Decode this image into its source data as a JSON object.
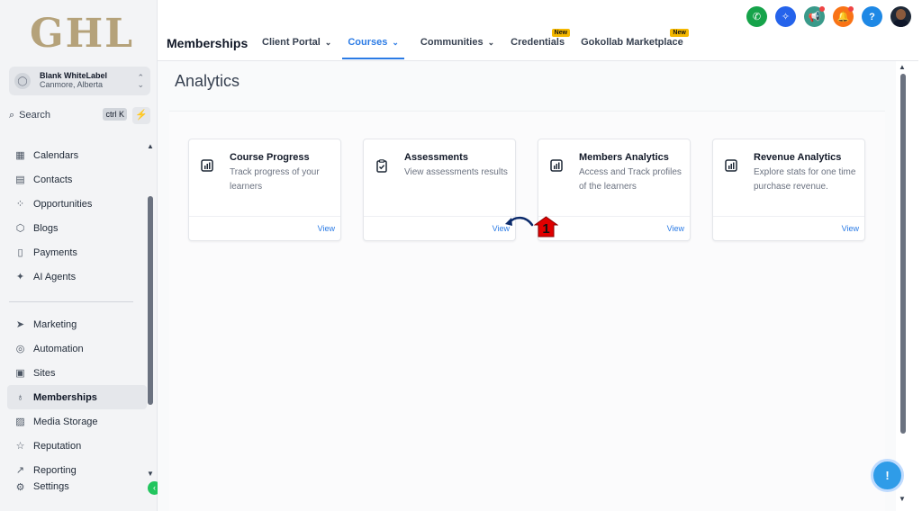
{
  "brand": {
    "logo_text": "GHL"
  },
  "account": {
    "name": "Blank WhiteLabel",
    "location": "Canmore, Alberta"
  },
  "search": {
    "label": "Search",
    "shortcut": "ctrl K"
  },
  "sidebar": {
    "items": [
      {
        "label": "Calendars",
        "icon": "calendar-icon",
        "glyph": "▦"
      },
      {
        "label": "Contacts",
        "icon": "contacts-icon",
        "glyph": "▤"
      },
      {
        "label": "Opportunities",
        "icon": "opportunities-icon",
        "glyph": "⁘"
      },
      {
        "label": "Blogs",
        "icon": "blog-icon",
        "glyph": "⬡"
      },
      {
        "label": "Payments",
        "icon": "payments-icon",
        "glyph": "▯"
      },
      {
        "label": "AI Agents",
        "icon": "ai-agents-icon",
        "glyph": "✦"
      }
    ],
    "items2": [
      {
        "label": "Marketing",
        "icon": "send-icon",
        "glyph": "➤"
      },
      {
        "label": "Automation",
        "icon": "automation-icon",
        "glyph": "◎"
      },
      {
        "label": "Sites",
        "icon": "sites-icon",
        "glyph": "▣"
      },
      {
        "label": "Memberships",
        "icon": "award-icon",
        "glyph": "♁"
      },
      {
        "label": "Media Storage",
        "icon": "image-icon",
        "glyph": "▨"
      },
      {
        "label": "Reputation",
        "icon": "star-icon",
        "glyph": "☆"
      },
      {
        "label": "Reporting",
        "icon": "trend-icon",
        "glyph": "↗"
      },
      {
        "label": "Settings",
        "icon": "gear-icon",
        "glyph": "⚙"
      }
    ],
    "active": "Memberships"
  },
  "header": {
    "title": "Memberships",
    "tabs": [
      {
        "label": "Client Portal",
        "dropdown": true
      },
      {
        "label": "Courses",
        "dropdown": true,
        "active": true
      },
      {
        "label": "Communities",
        "dropdown": true
      },
      {
        "label": "Credentials",
        "badge": "New"
      },
      {
        "label": "Gokollab Marketplace",
        "badge": "New"
      }
    ]
  },
  "main": {
    "section_title": "Analytics",
    "cards": [
      {
        "title": "Course Progress",
        "description": "Track progress of your learners",
        "action": "View",
        "icon": "chart-icon"
      },
      {
        "title": "Assessments",
        "description": "View assessments results",
        "action": "View",
        "icon": "clipboard-check-icon"
      },
      {
        "title": "Members Analytics",
        "description": "Access and Track profiles of the learners",
        "action": "View",
        "icon": "chart-icon"
      },
      {
        "title": "Revenue Analytics",
        "description": "Explore stats for one time purchase revenue.",
        "action": "View",
        "icon": "chart-icon"
      }
    ]
  },
  "annotation": {
    "step_number": "1"
  },
  "colors": {
    "accent": "#2b7be5",
    "phone": "#16a34a",
    "magic": "#2563eb",
    "megaphone": "#3a9a8a",
    "bell": "#f97316",
    "help": "#1e88e5",
    "badge": "#f5b800",
    "step_red": "#e00000"
  }
}
